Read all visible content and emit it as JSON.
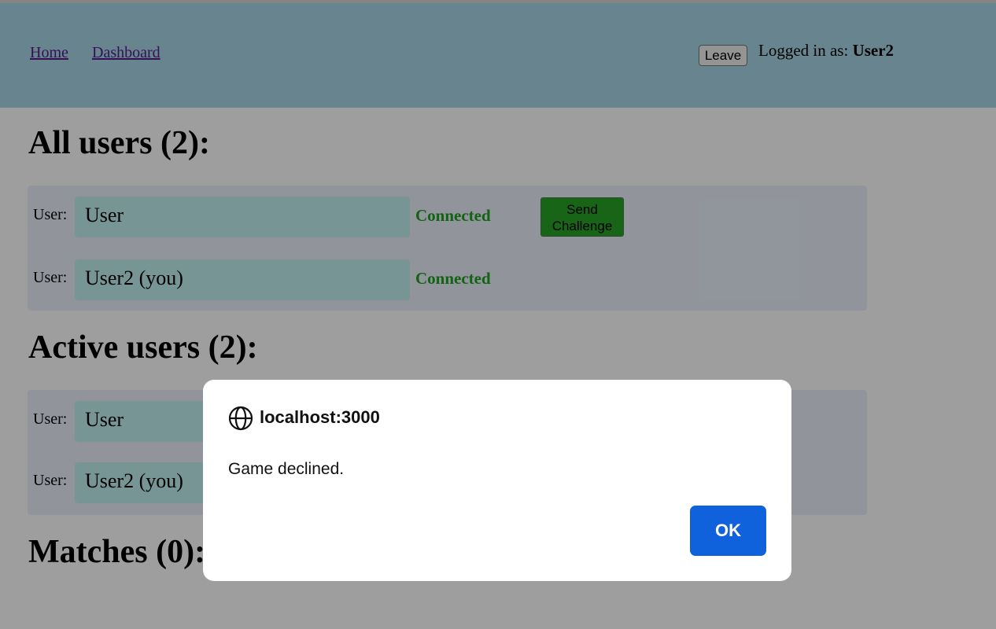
{
  "nav": {
    "home": "Home",
    "dashboard": "Dashboard"
  },
  "header": {
    "leave_label": "Leave",
    "logged_in_prefix": "Logged in as:",
    "username": "User2"
  },
  "sections": {
    "all_users_title": "All users (2):",
    "active_users_title": "Active users (2):",
    "matches_title": "Matches (0):"
  },
  "all_users": [
    {
      "label": "User:",
      "name": "User",
      "status": "Connected",
      "action": "Send Challenge"
    },
    {
      "label": "User:",
      "name": "User2 (you)",
      "status": "Connected"
    }
  ],
  "active_users": [
    {
      "label": "User:",
      "name": "User"
    },
    {
      "label": "User:",
      "name": "User2 (you)"
    }
  ],
  "dialog": {
    "origin": "localhost:3000",
    "message": "Game declined.",
    "ok_label": "OK",
    "icon": "globe-icon"
  },
  "colors": {
    "header_bg": "#a9d6e6",
    "status_connected": "#1ea01e",
    "challenge_button": "#28a328",
    "ok_button": "#0f62dc"
  }
}
